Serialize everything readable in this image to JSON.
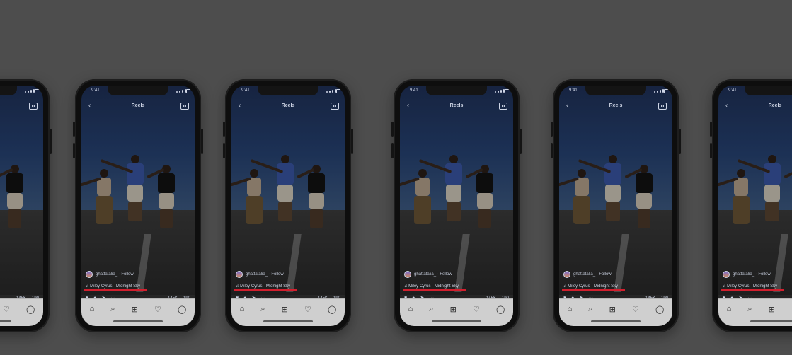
{
  "reels": {
    "status_time": "9:41",
    "title": "Reels",
    "username_line": "ghattatalia_ · Follow",
    "music_line": "♫ Miley Cyrus · Midnight Sky",
    "likes": "145K",
    "comments": "190"
  },
  "icons": {
    "back": "chevron-left-icon",
    "camera": "camera-icon",
    "like": "heart-icon",
    "comment": "comment-icon",
    "share": "paper-plane-icon",
    "more": "more-icon",
    "nav": [
      "home-icon",
      "search-icon",
      "add-icon",
      "heart-icon",
      "profile-icon"
    ]
  },
  "colors": {
    "background": "#6b6b6b",
    "music_underline": "#d21f2e"
  }
}
